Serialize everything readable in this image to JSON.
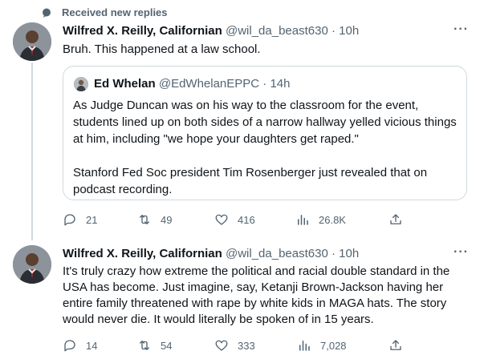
{
  "header": {
    "received_label": "Received new replies"
  },
  "tweets": [
    {
      "name": "Wilfred X. Reilly, Californian",
      "handle": "@wil_da_beast630",
      "time": "· 10h",
      "text": "Bruh. This happened at a law school.",
      "more": "···",
      "quote": {
        "name": "Ed Whelan",
        "handle": "@EdWhelanEPPC",
        "time": "· 14h",
        "paragraph1": "As Judge Duncan was on his way to the classroom for the event, students lined up on both sides of a narrow hallway yelled vicious things at him, including \"we hope your daughters get raped.\"",
        "paragraph2": "Stanford Fed Soc president Tim Rosenberger just revealed that on podcast recording."
      },
      "stats": {
        "replies": "21",
        "retweets": "49",
        "likes": "416",
        "views": "26.8K"
      }
    },
    {
      "name": "Wilfred X. Reilly, Californian",
      "handle": "@wil_da_beast630",
      "time": "· 10h",
      "text": "It's truly crazy how extreme the political and racial double standard in the USA has become. Just imagine, say, Ketanji Brown-Jackson having her entire family threatened with rape by white kids in MAGA hats. The story would never die. It would literally be spoken of in 15 years.",
      "more": "···",
      "stats": {
        "replies": "14",
        "retweets": "54",
        "likes": "333",
        "views": "7,028"
      }
    }
  ],
  "colors": {
    "secondary_text": "#536471",
    "border": "#cfd9de",
    "primary_text": "#0f1419"
  }
}
